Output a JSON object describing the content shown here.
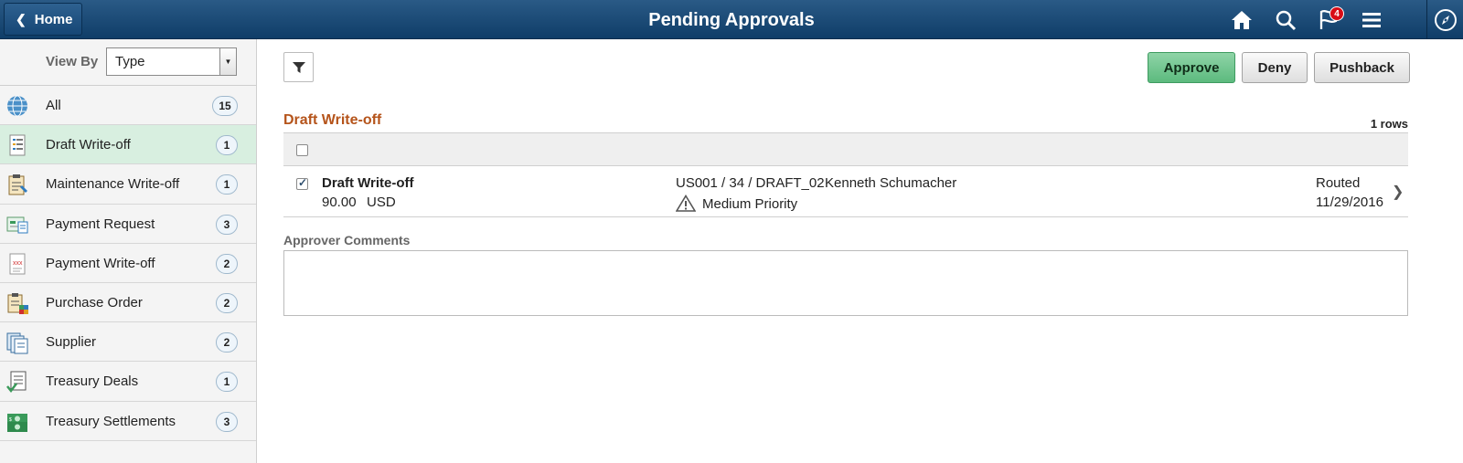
{
  "header": {
    "home_label": "Home",
    "title": "Pending Approvals",
    "notifications_count": "4",
    "icons": [
      "home-icon",
      "search-icon",
      "flag-icon",
      "menu-icon",
      "compass-icon"
    ]
  },
  "sidebar": {
    "view_by_label": "View By",
    "view_by_value": "Type",
    "items": [
      {
        "label": "All",
        "count": "15",
        "icon": "globe-icon"
      },
      {
        "label": "Draft Write-off",
        "count": "1",
        "icon": "document-list-icon",
        "active": true
      },
      {
        "label": "Maintenance Write-off",
        "count": "1",
        "icon": "clipboard-icon"
      },
      {
        "label": "Payment Request",
        "count": "3",
        "icon": "payment-icon"
      },
      {
        "label": "Payment Write-off",
        "count": "2",
        "icon": "document-x-icon"
      },
      {
        "label": "Purchase Order",
        "count": "2",
        "icon": "purchase-order-icon"
      },
      {
        "label": "Supplier",
        "count": "2",
        "icon": "supplier-icon"
      },
      {
        "label": "Treasury Deals",
        "count": "1",
        "icon": "treasury-deals-icon"
      },
      {
        "label": "Treasury Settlements",
        "count": "3",
        "icon": "money-icon"
      }
    ]
  },
  "toolbar": {
    "approve_label": "Approve",
    "deny_label": "Deny",
    "pushback_label": "Pushback"
  },
  "section": {
    "title": "Draft Write-off",
    "rows_count": "1 rows"
  },
  "rows": [
    {
      "title": "Draft Write-off",
      "amount": "90.00",
      "currency": "USD",
      "reference": "US001 / 34 / DRAFT_02",
      "person": "Kenneth Schumacher",
      "priority": "Medium Priority",
      "status": "Routed",
      "date": "11/29/2016",
      "checked": true
    }
  ],
  "comments": {
    "label": "Approver Comments",
    "value": ""
  },
  "colors": {
    "header_bg": "#1a4a78",
    "approve_bg": "#6cc28b",
    "section_title": "#b5541b",
    "active_item_bg": "#d8efe0"
  }
}
